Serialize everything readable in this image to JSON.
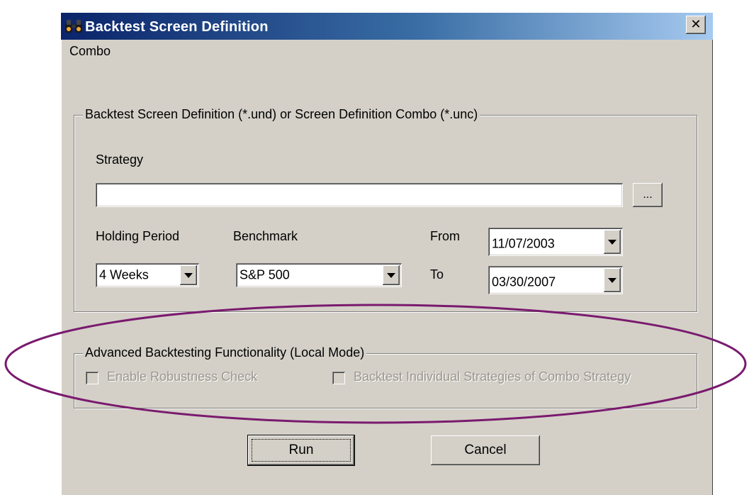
{
  "window": {
    "title": "Backtest Screen Definition",
    "title_icon": "binoculars-icon",
    "close_label": "✕"
  },
  "menu": {
    "items": [
      "Combo"
    ]
  },
  "definition_group": {
    "legend": "Backtest Screen Definition (*.und) or Screen Definition Combo (*.unc)",
    "strategy_label": "Strategy",
    "strategy_value": "",
    "browse_label": "...",
    "holding_period_label": "Holding Period",
    "holding_period_value": "4 Weeks",
    "benchmark_label": "Benchmark",
    "benchmark_value": "S&P 500",
    "from_label": "From",
    "from_value": "11/07/2003",
    "to_label": "To",
    "to_value": "03/30/2007"
  },
  "advanced_group": {
    "legend": "Advanced Backtesting Functionality (Local Mode)",
    "robustness_label": "Enable Robustness Check",
    "robustness_checked": false,
    "individual_label": "Backtest Individual Strategies of Combo Strategy",
    "individual_checked": false
  },
  "buttons": {
    "run": "Run",
    "cancel": "Cancel"
  },
  "colors": {
    "dialog_bg": "#d4d0c8",
    "titlebar_start": "#0a246a",
    "titlebar_end": "#a6caf0",
    "annotation_ellipse": "#7a1a6e",
    "disabled_text": "#9b978f"
  }
}
